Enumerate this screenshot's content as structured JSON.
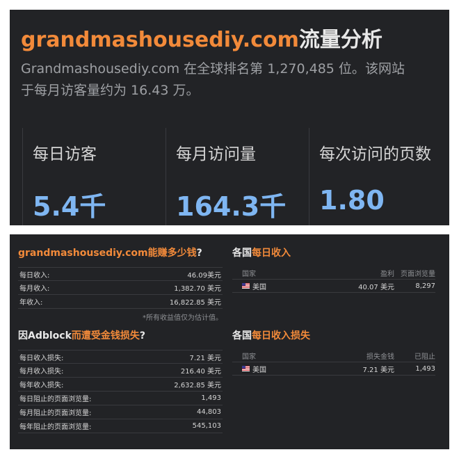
{
  "top": {
    "title_domain": "grandmashousediy.com",
    "title_suffix": "流量分析",
    "description_line1": "Grandmashousediy.com 在全球排名第 1,270,485 位。该网站",
    "description_line2": "于每月访客量约为 16.43 万。",
    "stats": [
      {
        "label": "每日访客",
        "value": "5.4千"
      },
      {
        "label": "每月访问量",
        "value": "164.3千"
      },
      {
        "label": "每次访问的页数",
        "value": "1.80"
      }
    ]
  },
  "earnings": {
    "title_domain": "grandmashousediy.com",
    "title_accent": "能赚多少钱",
    "title_end": "?",
    "rows": [
      {
        "label": "每日收入:",
        "value": "46.09美元"
      },
      {
        "label": "每月收入:",
        "value": "1,382.70 美元"
      },
      {
        "label": "年收入:",
        "value": "16,822.85 美元"
      }
    ],
    "note": "*所有收益值仅为估计值。"
  },
  "adblock": {
    "title_start": "因Adblock",
    "title_accent": "而遭受金钱损失",
    "title_end": "?",
    "rows": [
      {
        "label": "每日收入损失:",
        "value": "7.21 美元"
      },
      {
        "label": "每月收入损失:",
        "value": "216.40 美元"
      },
      {
        "label": "每年收入损失:",
        "value": "2,632.85 美元"
      },
      {
        "label": "每日阻止的页面浏览量:",
        "value": "1,493"
      },
      {
        "label": "每月阻止的页面浏览量:",
        "value": "44,803"
      },
      {
        "label": "每年阻止的页面浏览量:",
        "value": "545,103"
      }
    ]
  },
  "country_income": {
    "title_start": "各国",
    "title_accent": "每日收入",
    "headers": [
      "国家",
      "盈利",
      "页面浏览量"
    ],
    "row": {
      "country": "美国",
      "flag_icon": "us-flag-icon",
      "col2": "40.07 美元",
      "col3": "8,297"
    }
  },
  "country_loss": {
    "title_start": "各国",
    "title_accent": "每日收入损失",
    "headers": [
      "国家",
      "损失金钱",
      "已阻止"
    ],
    "row": {
      "country": "美国",
      "flag_icon": "us-flag-icon",
      "col2": "7.21 美元",
      "col3": "1,493"
    }
  },
  "colors": {
    "accent_orange": "#f28a3a",
    "stat_blue": "#7fb6f2",
    "panel_bg": "#222326"
  }
}
